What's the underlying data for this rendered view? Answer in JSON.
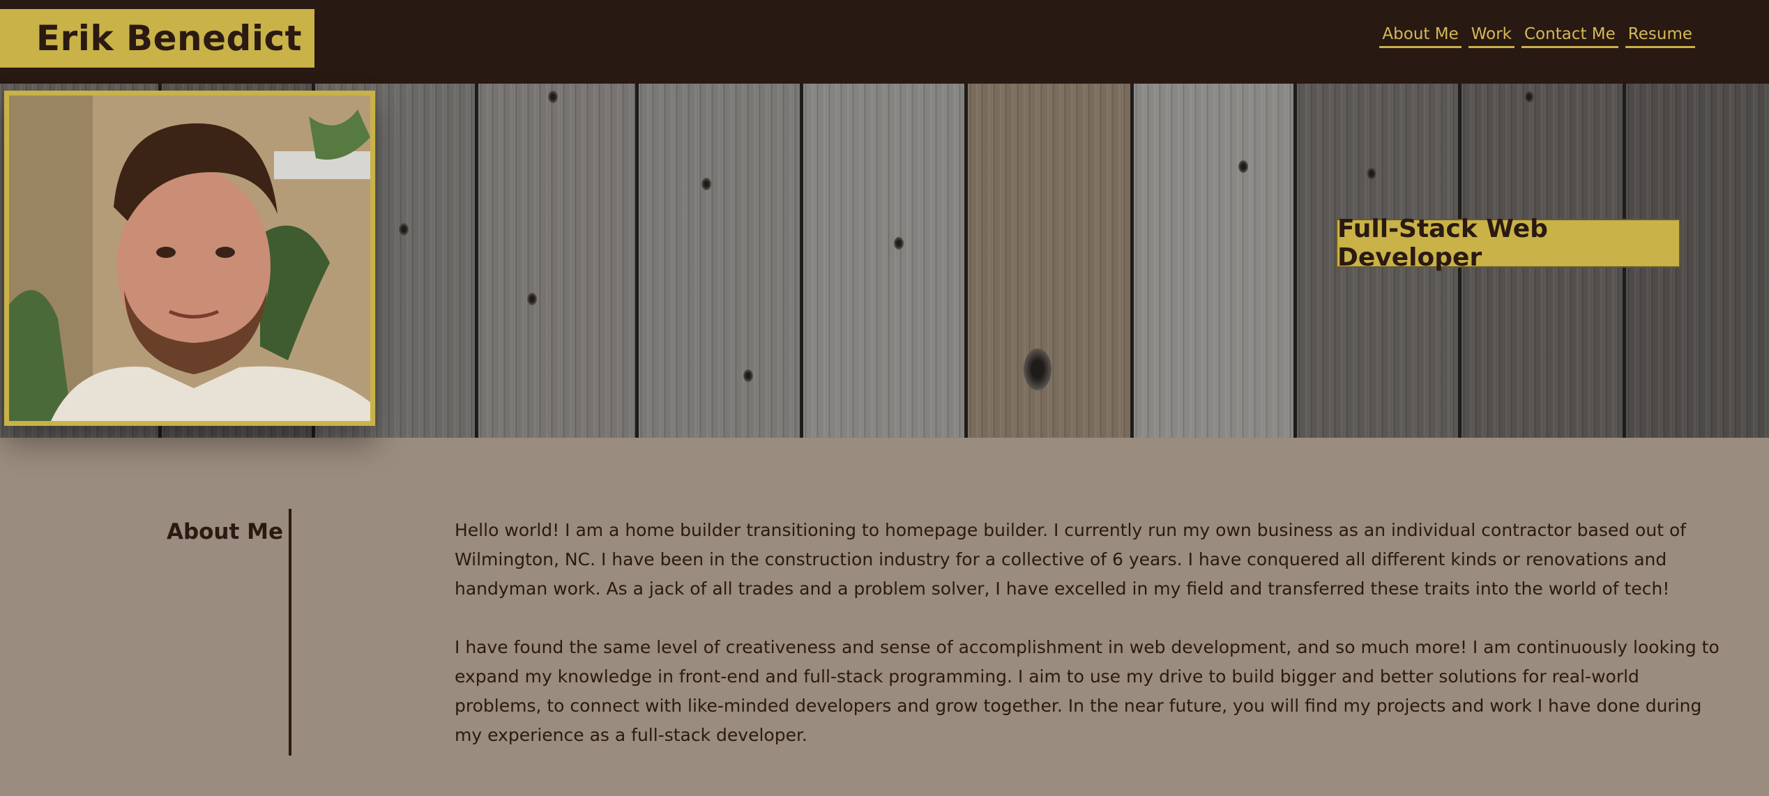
{
  "header": {
    "brand_name": "Erik Benedict",
    "nav": [
      {
        "label": "About Me"
      },
      {
        "label": "Work"
      },
      {
        "label": "Contact Me"
      },
      {
        "label": "Resume"
      }
    ]
  },
  "hero": {
    "tagline": "Full-Stack Web Developer"
  },
  "about": {
    "title": "About Me",
    "paragraphs": [
      "Hello world! I am a home builder transitioning to homepage builder. I currently run my own business as an individual contractor based out of Wilmington, NC. I have been in the construction industry for a collective of 6 years. I have conquered all different kinds or renovations and handyman work. As a jack of all trades and a problem solver, I have excelled in my field and transferred these traits into the world of tech!",
      "I have found the same level of creativeness and sense of accomplishment in web development, and so much more! I am continuously looking to expand my knowledge in front-end and full-stack programming. I aim to use my drive to build bigger and better solutions for real-world problems, to connect with like-minded developers and grow together. In the near future, you will find my projects and work I have done during my experience as a full-stack developer."
    ]
  },
  "colors": {
    "header_bg": "#281912",
    "accent_gold": "#c9b248",
    "nav_text": "#d4b85a",
    "page_bg": "#9a8c7e",
    "text_dark": "#2a1a12"
  }
}
